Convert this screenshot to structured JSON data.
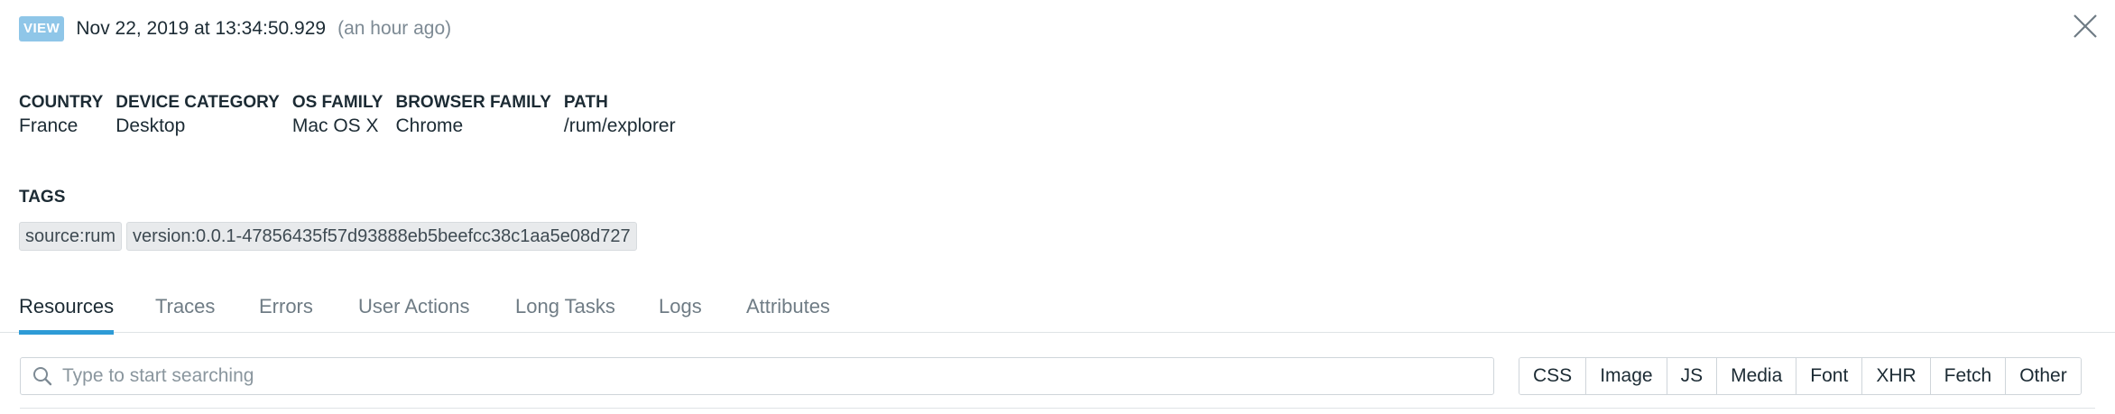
{
  "header": {
    "badge": "VIEW",
    "timestamp": "Nov 22, 2019 at 13:34:50.929",
    "relative_time": "(an hour ago)"
  },
  "attributes": [
    {
      "key": "COUNTRY",
      "value": "France"
    },
    {
      "key": "DEVICE CATEGORY",
      "value": "Desktop"
    },
    {
      "key": "OS FAMILY",
      "value": "Mac OS X"
    },
    {
      "key": "BROWSER FAMILY",
      "value": "Chrome"
    },
    {
      "key": "PATH",
      "value": "/rum/explorer"
    }
  ],
  "tags": {
    "title": "TAGS",
    "items": [
      "source:rum",
      "version:0.0.1-47856435f57d93888eb5beefcc38c1aa5e08d727"
    ]
  },
  "tabs": [
    {
      "label": "Resources",
      "active": true
    },
    {
      "label": "Traces"
    },
    {
      "label": "Errors"
    },
    {
      "label": "User Actions"
    },
    {
      "label": "Long Tasks"
    },
    {
      "label": "Logs"
    },
    {
      "label": "Attributes"
    }
  ],
  "search": {
    "placeholder": "Type to start searching",
    "value": ""
  },
  "filters": [
    "CSS",
    "Image",
    "JS",
    "Media",
    "Font",
    "XHR",
    "Fetch",
    "Other"
  ],
  "icons": {
    "close": "close-icon",
    "search": "search-icon"
  },
  "colors": {
    "badge": "#8fc6e8",
    "active_tab_underline": "#2e9bd6"
  }
}
